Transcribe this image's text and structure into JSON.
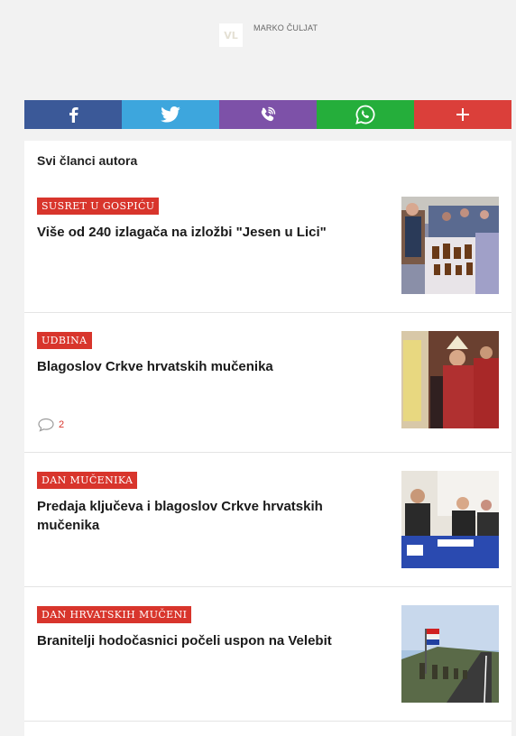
{
  "author": {
    "logo_text": "VL",
    "name": "MARKO ČULJAT"
  },
  "share": {
    "buttons": [
      {
        "name": "facebook",
        "icon": "facebook-icon",
        "color": "#3b5998"
      },
      {
        "name": "twitter",
        "icon": "twitter-icon",
        "color": "#3da6dd"
      },
      {
        "name": "viber",
        "icon": "viber-icon",
        "color": "#7d51a8"
      },
      {
        "name": "whatsapp",
        "icon": "whatsapp-icon",
        "color": "#25ae3b"
      },
      {
        "name": "more",
        "icon": "plus-icon",
        "color": "#db3f3a"
      }
    ]
  },
  "section": {
    "title": "Svi članci autora"
  },
  "articles": [
    {
      "tag": "SUSRET U GOSPIĆU",
      "title": "Više od 240 izlagača na izložbi \"Jesen u Lici\"",
      "comments": ""
    },
    {
      "tag": "UDBINA",
      "title": "Blagoslov Crkve hrvatskih mučenika",
      "comments": "2"
    },
    {
      "tag": "DAN MUČENIKA",
      "title": "Predaja ključeva i blagoslov Crkve hrvatskih mučenika",
      "comments": ""
    },
    {
      "tag": "DAN HRVATSKIH MUČENI",
      "title": "Branitelji hodočasnici počeli uspon na Velebit",
      "comments": ""
    }
  ],
  "colors": {
    "accent": "#d8352c",
    "page_bg": "#f2f2f2"
  }
}
